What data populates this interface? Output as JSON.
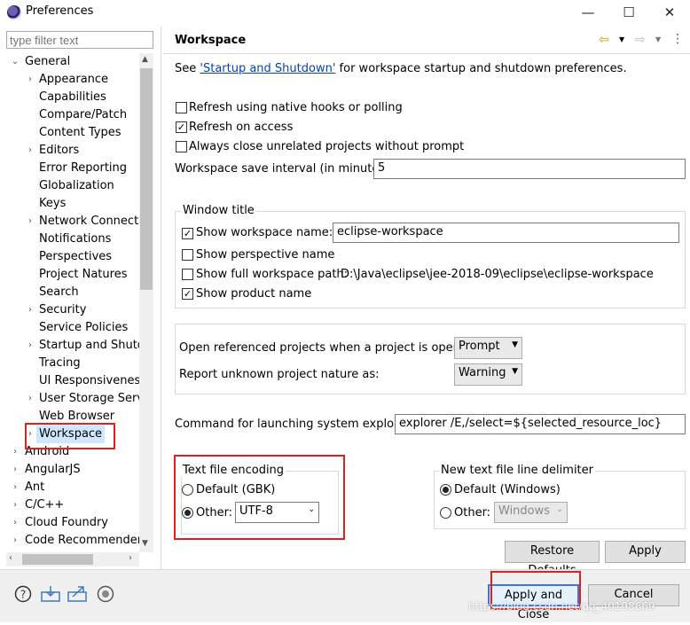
{
  "window": {
    "title": "Preferences",
    "minimize": "—",
    "maximize": "☐",
    "close": "✕"
  },
  "left": {
    "filter_placeholder": "type filter text",
    "tree": [
      {
        "label": "General",
        "chev": "⌄"
      },
      {
        "label": "Appearance",
        "chev": "›"
      },
      {
        "label": "Capabilities",
        "chev": ""
      },
      {
        "label": "Compare/Patch",
        "chev": ""
      },
      {
        "label": "Content Types",
        "chev": ""
      },
      {
        "label": "Editors",
        "chev": "›"
      },
      {
        "label": "Error Reporting",
        "chev": ""
      },
      {
        "label": "Globalization",
        "chev": ""
      },
      {
        "label": "Keys",
        "chev": ""
      },
      {
        "label": "Network Connectio",
        "chev": "›"
      },
      {
        "label": "Notifications",
        "chev": ""
      },
      {
        "label": "Perspectives",
        "chev": ""
      },
      {
        "label": "Project Natures",
        "chev": ""
      },
      {
        "label": "Search",
        "chev": ""
      },
      {
        "label": "Security",
        "chev": "›"
      },
      {
        "label": "Service Policies",
        "chev": ""
      },
      {
        "label": "Startup and Shutdo",
        "chev": "›"
      },
      {
        "label": "Tracing",
        "chev": ""
      },
      {
        "label": "UI Responsiveness",
        "chev": ""
      },
      {
        "label": "User Storage Servic",
        "chev": "›"
      },
      {
        "label": "Web Browser",
        "chev": ""
      },
      {
        "label": "Workspace",
        "chev": "›"
      },
      {
        "label": "Android",
        "chev": "›"
      },
      {
        "label": "AngularJS",
        "chev": "›"
      },
      {
        "label": "Ant",
        "chev": "›"
      },
      {
        "label": "C/C++",
        "chev": "›"
      },
      {
        "label": "Cloud Foundry",
        "chev": "›"
      },
      {
        "label": "Code Recommenders",
        "chev": "›"
      }
    ]
  },
  "right": {
    "title": "Workspace",
    "see_prefix": "See ",
    "see_link": "'Startup and Shutdown'",
    "see_suffix": " for workspace startup and shutdown preferences.",
    "opt_refresh_native": "Refresh using native hooks or polling",
    "opt_refresh_access": "Refresh on access",
    "opt_close_unrelated": "Always close unrelated projects without prompt",
    "save_interval_label": "Workspace save interval (in minutes):",
    "save_interval_value": "5",
    "window_title_group": "Window title",
    "show_ws_name": "Show workspace name:",
    "ws_name_value": "eclipse-workspace",
    "show_perspective": "Show perspective name",
    "show_full_path": "Show full workspace path:",
    "full_path_value": "D:\\Java\\eclipse\\jee-2018-09\\eclipse\\eclipse-workspace",
    "show_product": "Show product name",
    "open_ref_label": "Open referenced projects when a project is opened:",
    "open_ref_value": "Prompt",
    "unknown_nature_label": "Report unknown project nature as:",
    "unknown_nature_value": "Warning",
    "cmd_label": "Command for launching system explorer:",
    "cmd_value": "explorer /E,/select=${selected_resource_loc}",
    "encoding_group": "Text file encoding",
    "enc_default": "Default (GBK)",
    "enc_other": "Other:",
    "enc_other_value": "UTF-8",
    "delim_group": "New text file line delimiter",
    "delim_default": "Default (Windows)",
    "delim_other": "Other:",
    "delim_other_value": "Windows",
    "restore_defaults": "Restore Defaults",
    "apply": "Apply"
  },
  "footer": {
    "apply_close": "Apply and Close",
    "cancel": "Cancel",
    "watermark": "https://blog.csdn.net/qq_40198669"
  }
}
